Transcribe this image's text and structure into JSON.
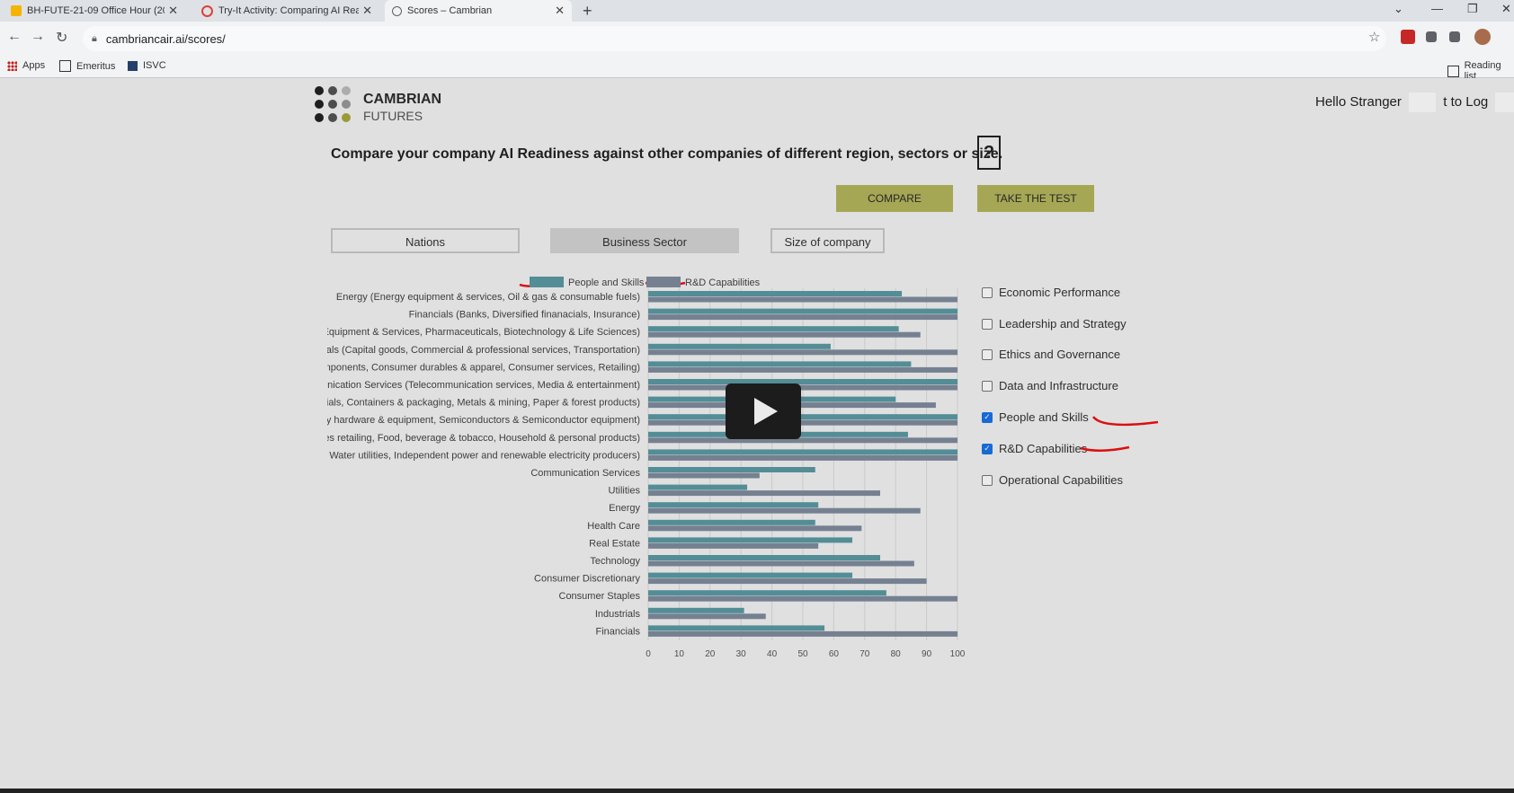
{
  "browser": {
    "tabs": [
      {
        "title": "BH-FUTE-21-09 Office Hour (202",
        "active": false,
        "favicon_color": "#f4b400"
      },
      {
        "title": "Try-It Activity: Comparing AI Rea",
        "active": false,
        "favicon_color": "#db4437"
      },
      {
        "title": "Scores – Cambrian",
        "active": true,
        "favicon_color": "#5f6368"
      }
    ],
    "url": "cambriancair.ai/scores/",
    "bookmarks": [
      "Apps",
      "Emeritus",
      "ISVC"
    ],
    "reading_list": "Reading list"
  },
  "header": {
    "logo_line1": "CAMBRIAN",
    "logo_line2": "FUTURES",
    "greeting": "Hello Stranger",
    "login_text": "t to Log"
  },
  "headline": "Compare your company AI Readiness against other companies of different region, sectors or size.",
  "help_label": "?",
  "buttons": {
    "compare": "COMPARE",
    "take_test": "TAKE THE TEST"
  },
  "segments": [
    {
      "label": "Nations",
      "selected": false
    },
    {
      "label": "Business Sector",
      "selected": true
    },
    {
      "label": "Size of company",
      "selected": false
    }
  ],
  "filters": [
    {
      "label": "Economic Performance",
      "checked": false
    },
    {
      "label": "Leadership and Strategy",
      "checked": false
    },
    {
      "label": "Ethics and Governance",
      "checked": false
    },
    {
      "label": "Data and Infrastructure",
      "checked": false
    },
    {
      "label": "People and Skills",
      "checked": true
    },
    {
      "label": "R&D Capabilities",
      "checked": true
    },
    {
      "label": "Operational Capabilities",
      "checked": false
    }
  ],
  "chart_data": {
    "type": "bar",
    "orientation": "horizontal",
    "categories": [
      "Energy (Energy equipment & services, Oil & gas & consumable fuels)",
      "Financials (Banks, Diversified finanacials, Insurance)",
      "Health Care Equipment & Services, Pharmaceuticals, Biotechnology & Life Sciences)",
      "Industrials (Capital goods, Commercial & professional services, Transportation)",
      "Consumer Discretionary (Automobiles & components, Consumer durables & apparel, Consumer services, Retailing)",
      "Communication Services (Telecommunication services, Media & entertainment)",
      "Materials (Chemicals, Containers & packaging, Metals & mining, Paper & forest products)",
      "Information Technology (Software & services, Technology hardware & equipment, Semiconductors & Semiconductor equipment)",
      "Consumer Staples (Food & staples retailing, Food, beverage & tobacco, Household & personal products)",
      "Utilities (Electric utilities, Gas utilities, Multi-utilities, Water utilities, Independent power and renewable electricity producers)",
      "Communication Services",
      "Utilities",
      "Energy",
      "Health Care",
      "Real Estate",
      "Technology",
      "Consumer Discretionary",
      "Consumer Staples",
      "Industrials",
      "Financials"
    ],
    "visible_labels": [
      "Energy (Energy equipment & services, Oil & gas & consumable fuels)",
      "Financials (Banks, Diversified finanacials, Insurance)",
      "e Equipment & Services, Pharmaceuticals, Biotechnology & Life Sciences)",
      "trials (Capital goods, Commercial & professional services, Transportation)",
      "omponents, Consumer durables & apparel, Consumer services, Retailing)",
      "nunication Services (Telecommunication services, Media & entertainment)",
      "erials, Containers & packaging, Metals & mining, Paper & forest products)",
      "ogy hardware & equipment, Semiconductors & Semiconductor equipment)",
      "ples retailing, Food, beverage & tobacco, Household & personal products)",
      "s, Water utilities, Independent power and renewable electricity producers)",
      "Communication Services",
      "Utilities",
      "Energy",
      "Health Care",
      "Real Estate",
      "Technology",
      "Consumer Discretionary",
      "Consumer Staples",
      "Industrials",
      "Financials"
    ],
    "series": [
      {
        "name": "People and Skills",
        "color": "#5b9aa3",
        "values": [
          82,
          100,
          81,
          59,
          85,
          100,
          80,
          100,
          84,
          100,
          54,
          32,
          55,
          54,
          66,
          75,
          66,
          77,
          31,
          57
        ]
      },
      {
        "name": "R&D Capabilities",
        "color": "#7f8d9e",
        "values": [
          100,
          100,
          88,
          100,
          100,
          100,
          93,
          100,
          100,
          100,
          36,
          75,
          88,
          69,
          55,
          86,
          90,
          100,
          38,
          100
        ]
      }
    ],
    "xlim": [
      0,
      100
    ],
    "xticks": [
      0,
      10,
      20,
      30,
      40,
      50,
      60,
      70,
      80,
      90,
      100
    ],
    "legend_position": "top"
  }
}
